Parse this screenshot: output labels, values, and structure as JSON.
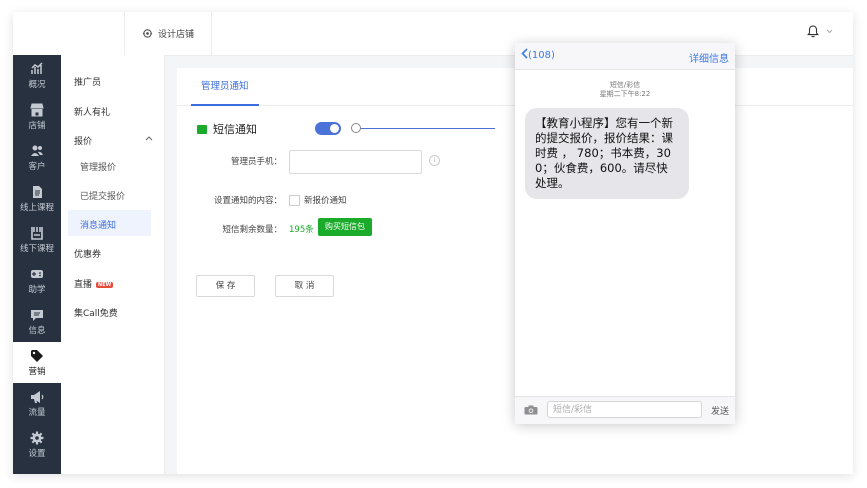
{
  "header": {
    "store_label": "设计店铺"
  },
  "nav": {
    "items": [
      {
        "label": "概况",
        "icon": "chart-icon"
      },
      {
        "label": "店铺",
        "icon": "store-icon"
      },
      {
        "label": "客户",
        "icon": "customers-icon"
      },
      {
        "label": "线上课程",
        "icon": "online-course-icon"
      },
      {
        "label": "线下课程",
        "icon": "offline-course-icon"
      },
      {
        "label": "助学",
        "icon": "gamepad-icon"
      },
      {
        "label": "信息",
        "icon": "message-icon"
      },
      {
        "label": "营销",
        "icon": "tag-icon"
      },
      {
        "label": "流量",
        "icon": "megaphone-icon"
      },
      {
        "label": "设置",
        "icon": "gear-icon"
      }
    ],
    "active_index": 7
  },
  "subnav": {
    "promoter": "推广员",
    "new_gift": "新人有礼",
    "quote": "报价",
    "manage_quote": "管理报价",
    "submitted_quote": "已提交报价",
    "message_notice": "消息通知",
    "coupon": "优惠券",
    "live": "直播",
    "new_badge": "NEW",
    "call_free": "集Call免费"
  },
  "main": {
    "tab": "管理员通知",
    "sms_title": "短信通知",
    "toggle_on": true,
    "phone_label": "管理员手机：",
    "phone_value": "",
    "notify_content_label": "设置通知的内容：",
    "new_quote_notice": "新报价通知",
    "remaining_label": "短信剩余数量：",
    "remaining_count": "195条",
    "buy_button": "购买短信包",
    "save_button": "保 存",
    "cancel_button": "取 消"
  },
  "phone_preview": {
    "back_label": "(108)",
    "detail_label": "详细信息",
    "meta_type": "短信/彩信",
    "meta_time": "星期二下午8:22",
    "message": "【教育小程序】您有一个新的提交报价，报价结果：课时费 ， 780；书本费，300；伙食费，600。请尽快处理。",
    "input_placeholder": "短信/彩信",
    "send_label": "发送"
  },
  "colors": {
    "accent": "#3c6cdd",
    "green": "#1aab2b",
    "nav_bg": "#273140"
  }
}
